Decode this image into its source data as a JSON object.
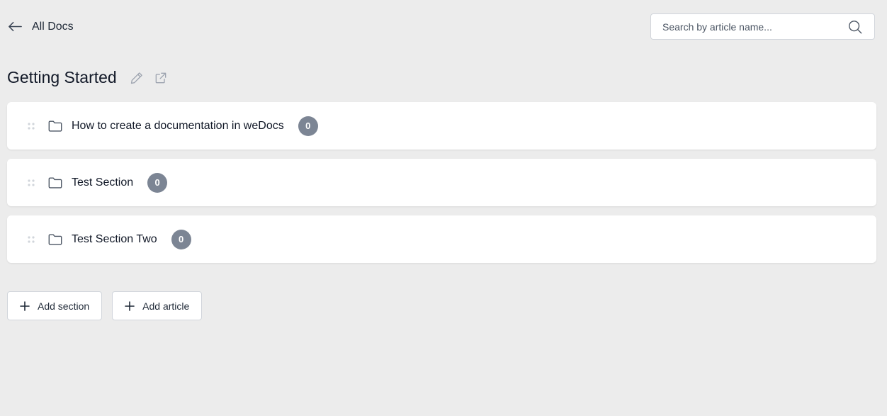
{
  "nav": {
    "back_label": "All Docs",
    "back_icon": "arrow-left-icon"
  },
  "search": {
    "placeholder": "Search by article name...",
    "value": "",
    "icon": "search-icon"
  },
  "doc": {
    "title": "Getting Started",
    "edit_icon": "pencil-icon",
    "open_icon": "external-link-icon"
  },
  "sections": [
    {
      "name": "How to create a documentation in weDocs",
      "count": "0"
    },
    {
      "name": "Test Section",
      "count": "0"
    },
    {
      "name": "Test Section Two",
      "count": "0"
    }
  ],
  "actions": {
    "add_section": "Add section",
    "add_article": "Add article"
  },
  "colors": {
    "background": "#ececec",
    "badge": "#7c8594",
    "text": "#111827"
  }
}
